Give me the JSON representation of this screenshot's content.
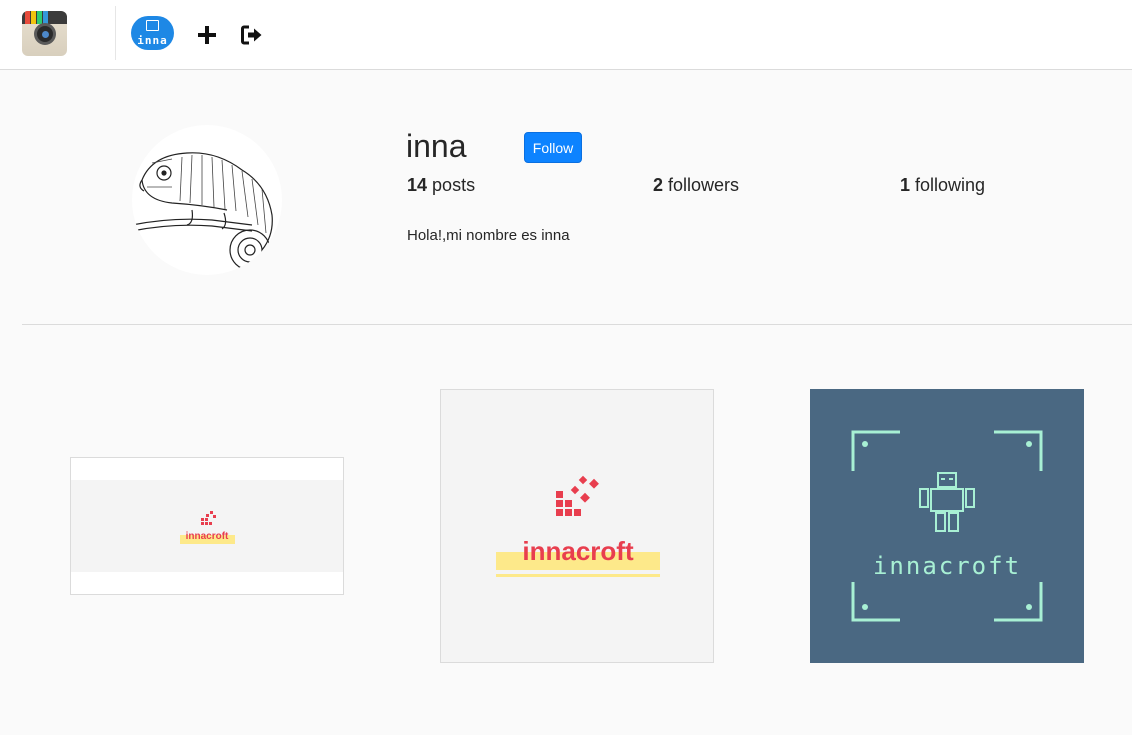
{
  "nav": {
    "avatar_text": "inna"
  },
  "profile": {
    "username": "inna",
    "follow_label": "Follow",
    "posts_count": "14",
    "posts_label": "posts",
    "followers_count": "2",
    "followers_label": "followers",
    "following_count": "1",
    "following_label": "following",
    "bio": "Hola!,mi nombre es inna"
  },
  "posts": [
    {
      "brand": "innacroft"
    },
    {
      "brand": "innacroft"
    },
    {
      "brand": "innacroft"
    }
  ],
  "colors": {
    "follow_blue": "#0d83ff",
    "brand_red": "#e83e4e",
    "brand_yellow": "#fde98a",
    "robot_bg": "#4a6882",
    "robot_mint": "#a8f0d4"
  }
}
